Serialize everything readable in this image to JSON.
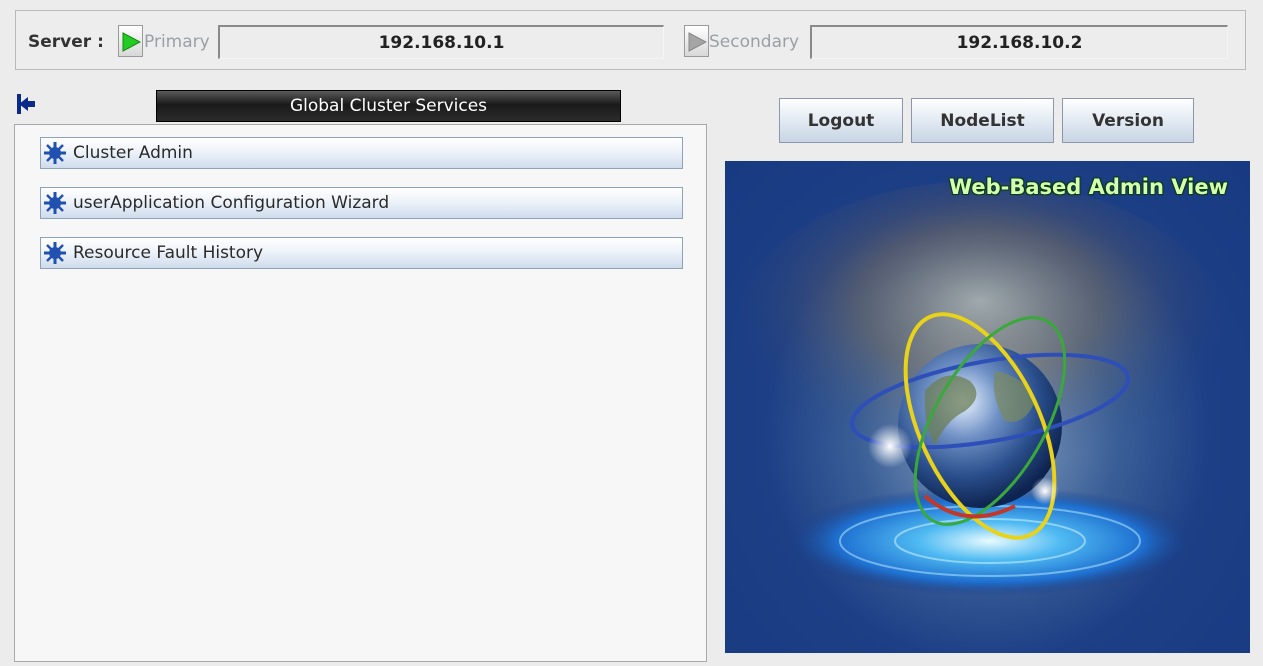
{
  "server": {
    "label": "Server :",
    "primary": {
      "name": "Primary",
      "ip": "192.168.10.1",
      "status_color": "#22cc22"
    },
    "secondary": {
      "name": "Secondary",
      "ip": "192.168.10.2",
      "status_color": "#9a9a9a"
    }
  },
  "left_panel": {
    "title": "Global Cluster Services",
    "back_icon": "back-arrow-icon",
    "items": [
      {
        "label": "Cluster Admin",
        "icon": "cluster-admin-icon"
      },
      {
        "label": "userApplication Configuration Wizard",
        "icon": "userapp-wizard-icon"
      },
      {
        "label": "Resource Fault History",
        "icon": "fault-history-icon"
      }
    ]
  },
  "toolbar": {
    "logout_label": "Logout",
    "nodelist_label": "NodeList",
    "version_label": "Version"
  },
  "logo": {
    "title": "Web-Based Admin View",
    "accent_color": "#1d3f86"
  }
}
